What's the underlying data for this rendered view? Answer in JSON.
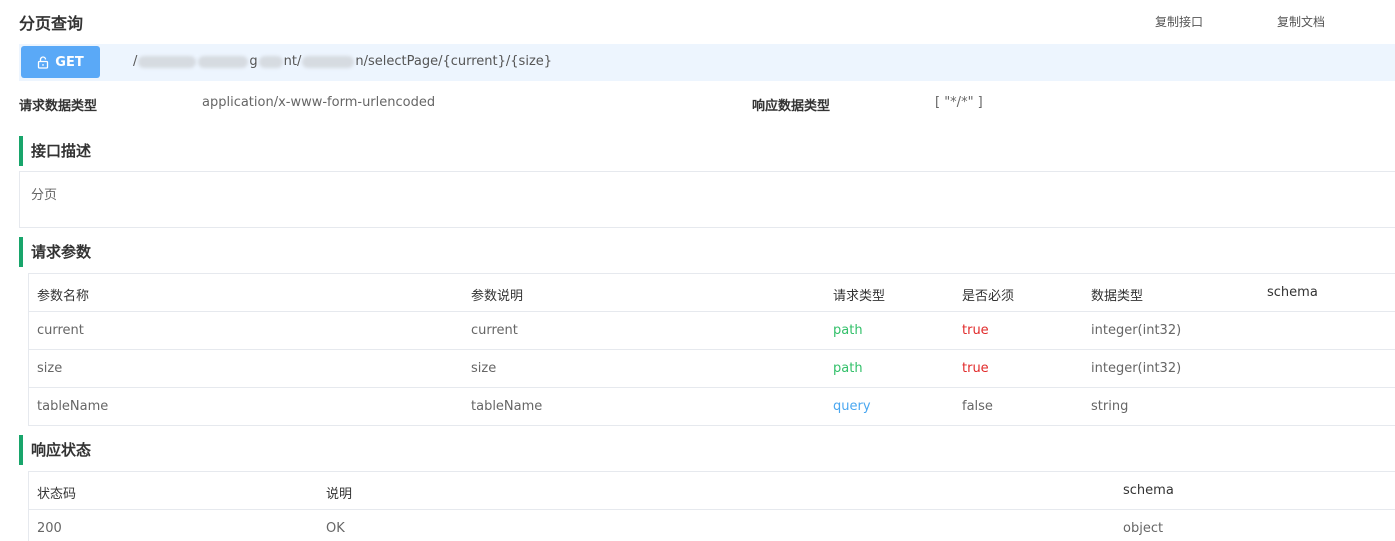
{
  "header": {
    "title": "分页查询",
    "copy_api": "复制接口",
    "copy_doc": "复制文档"
  },
  "request": {
    "method": "GET",
    "url_prefix": "/",
    "url_mid1": "g",
    "url_mid2": "nt/",
    "url_suffix": "n/selectPage/{current}/{size}"
  },
  "content_types": {
    "request_label": "请求数据类型",
    "request_value": "application/x-www-form-urlencoded",
    "response_label": "响应数据类型",
    "response_value": "[ \"*/*\" ]"
  },
  "description": {
    "title": "接口描述",
    "text": "分页"
  },
  "params": {
    "title": "请求参数",
    "headers": [
      "参数名称",
      "参数说明",
      "请求类型",
      "是否必须",
      "数据类型",
      "schema"
    ],
    "rows": [
      {
        "name": "current",
        "desc": "current",
        "in": "path",
        "required": "true",
        "type": "integer(int32)",
        "schema": ""
      },
      {
        "name": "size",
        "desc": "size",
        "in": "path",
        "required": "true",
        "type": "integer(int32)",
        "schema": ""
      },
      {
        "name": "tableName",
        "desc": "tableName",
        "in": "query",
        "required": "false",
        "type": "string",
        "schema": ""
      }
    ]
  },
  "responses": {
    "title": "响应状态",
    "headers": [
      "状态码",
      "说明",
      "schema"
    ],
    "rows": [
      {
        "code": "200",
        "desc": "OK",
        "schema": "object"
      }
    ]
  },
  "colors": {
    "accent": "#18a56b",
    "get_button": "#5aa9f7",
    "path": "#33c06a",
    "query": "#4aa7f0",
    "required_true": "#e12a2a"
  },
  "icons": {
    "get_button_icon": "unlock-icon"
  }
}
